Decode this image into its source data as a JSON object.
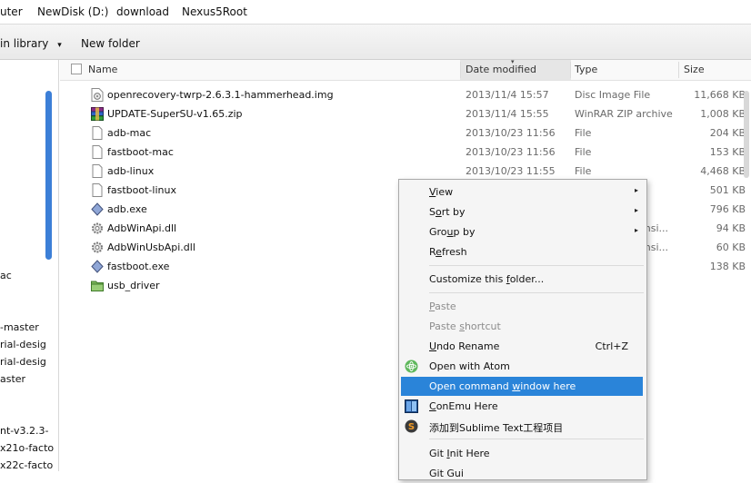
{
  "breadcrumb": {
    "items": [
      "uter",
      "NewDisk (D:)",
      "download",
      "Nexus5Root"
    ]
  },
  "toolbar": {
    "include_label": "in library",
    "include_arrow": "▾",
    "new_folder": "New folder"
  },
  "nav": {
    "items": [
      "ac",
      "-master",
      "rial-desig",
      "rial-desig",
      "aster",
      "nt-v3.2.3-",
      "x21o-facto",
      "x22c-facto"
    ]
  },
  "columns": {
    "name": "Name",
    "date": "Date modified",
    "type": "Type",
    "size": "Size"
  },
  "files": [
    {
      "name": "openrecovery-twrp-2.6.3.1-hammerhead.img",
      "date": "2013/11/4 15:57",
      "type": "Disc Image File",
      "size": "11,668 KB",
      "icon": "disc-image-icon"
    },
    {
      "name": "UPDATE-SuperSU-v1.65.zip",
      "date": "2013/11/4 15:55",
      "type": "WinRAR ZIP archive",
      "size": "1,008 KB",
      "icon": "winrar-archive-icon"
    },
    {
      "name": "adb-mac",
      "date": "2013/10/23 11:56",
      "type": "File",
      "size": "204 KB",
      "icon": "file-icon"
    },
    {
      "name": "fastboot-mac",
      "date": "2013/10/23 11:56",
      "type": "File",
      "size": "153 KB",
      "icon": "file-icon"
    },
    {
      "name": "adb-linux",
      "date": "2013/10/23 11:55",
      "type": "File",
      "size": "4,468 KB",
      "icon": "file-icon"
    },
    {
      "name": "fastboot-linux",
      "date": "",
      "type": "",
      "size": "501 KB",
      "icon": "file-icon"
    },
    {
      "name": "adb.exe",
      "date": "",
      "type": "",
      "size": "796 KB",
      "icon": "exe-icon"
    },
    {
      "name": "AdbWinApi.dll",
      "date": "",
      "type": "ensi...",
      "size": "94 KB",
      "icon": "dll-gear-icon"
    },
    {
      "name": "AdbWinUsbApi.dll",
      "date": "",
      "type": "ensi...",
      "size": "60 KB",
      "icon": "dll-gear-icon"
    },
    {
      "name": "fastboot.exe",
      "date": "",
      "type": "",
      "size": "138 KB",
      "icon": "exe-icon"
    },
    {
      "name": "usb_driver",
      "date": "",
      "type": "",
      "size": "",
      "icon": "folder-icon"
    }
  ],
  "context_menu": {
    "items": [
      {
        "pre": "",
        "key": "V",
        "post": "iew",
        "arrow": "▸",
        "disabled": false
      },
      {
        "pre": "S",
        "key": "o",
        "post": "rt by",
        "arrow": "▸",
        "disabled": false
      },
      {
        "pre": "Gro",
        "key": "u",
        "post": "p by",
        "arrow": "▸",
        "disabled": false
      },
      {
        "pre": "R",
        "key": "e",
        "post": "fresh",
        "arrow": "",
        "disabled": false
      },
      {
        "pre": "Customize this ",
        "key": "f",
        "post": "older...",
        "arrow": "",
        "disabled": false
      },
      {
        "pre": "",
        "key": "P",
        "post": "aste",
        "arrow": "",
        "disabled": true
      },
      {
        "pre": "Paste ",
        "key": "s",
        "post": "hortcut",
        "arrow": "",
        "disabled": true
      },
      {
        "pre": "",
        "key": "U",
        "post": "ndo Rename",
        "arrow": "",
        "shortcut": "Ctrl+Z",
        "disabled": false
      },
      {
        "pre": "Open with Atom",
        "key": "",
        "post": "",
        "arrow": "",
        "icon": "atom-icon",
        "disabled": false
      },
      {
        "pre": "Open command ",
        "key": "w",
        "post": "indow here",
        "arrow": "",
        "highlighted": true,
        "disabled": false
      },
      {
        "pre": "",
        "key": "C",
        "post": "onEmu Here",
        "arrow": "",
        "icon": "conemu-icon",
        "disabled": false
      },
      {
        "pre": "添加到Sublime Text工程项目",
        "key": "",
        "post": "",
        "arrow": "",
        "icon": "sublime-icon",
        "disabled": false
      },
      {
        "pre": "Git ",
        "key": "I",
        "post": "nit Here",
        "arrow": "",
        "disabled": false
      },
      {
        "pre": "Git Gui",
        "key": "",
        "post": "",
        "arrow": "",
        "disabled": false
      }
    ]
  },
  "colors": {
    "highlight": "#2a84d9",
    "nav_scroll": "#3c7fd7"
  }
}
